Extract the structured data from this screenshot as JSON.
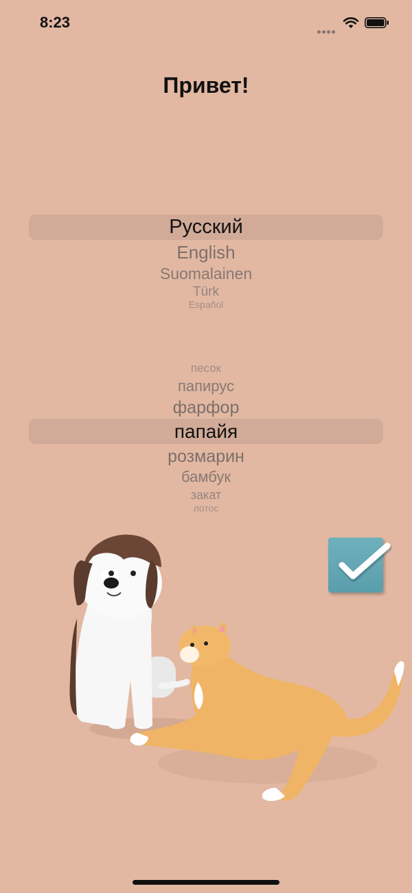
{
  "status_bar": {
    "time": "8:23"
  },
  "title": "Привет!",
  "language_picker": {
    "items": [
      "Русский",
      "English",
      "Suomalainen",
      "Türk",
      "Español"
    ],
    "selected": "Русский"
  },
  "theme_picker": {
    "items": [
      "песок",
      "папирус",
      "фарфор",
      "папайя",
      "розмарин",
      "бамбук",
      "закат",
      "лотос"
    ],
    "selected": "папайя"
  },
  "colors": {
    "background": "#e2b8a2",
    "checkbox": "#5fa3b0",
    "text": "#111111"
  },
  "icons": [
    "signal-icon",
    "wifi-icon",
    "battery-icon",
    "checkmark-icon",
    "dog-illustration",
    "cat-illustration"
  ]
}
